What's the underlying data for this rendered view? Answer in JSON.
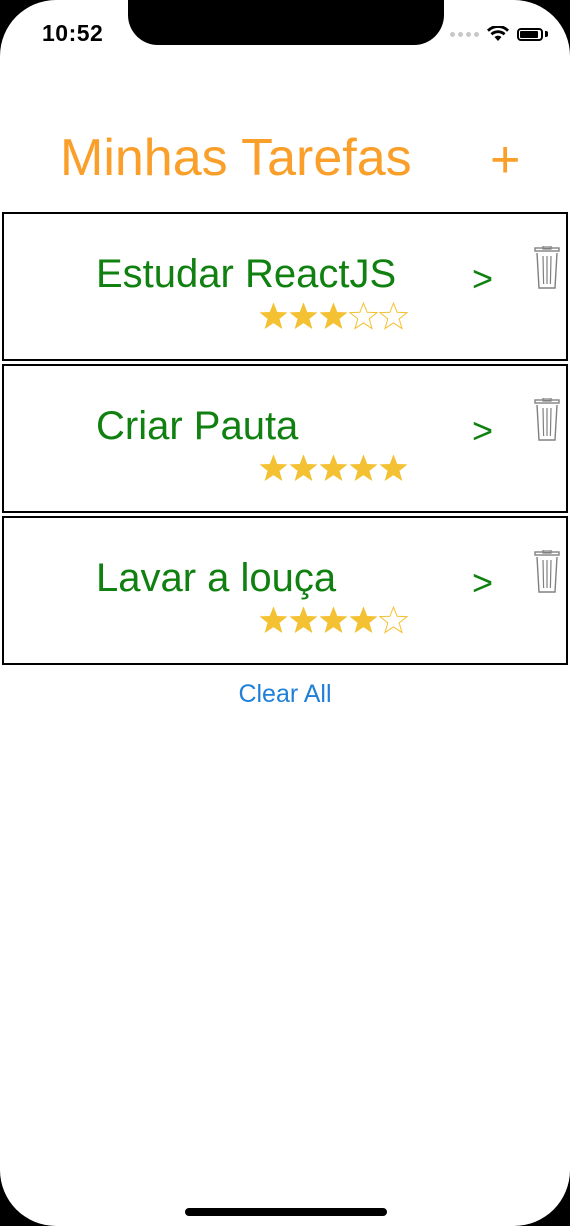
{
  "status_bar": {
    "time": "10:52"
  },
  "header": {
    "title": "Minhas Tarefas",
    "add_label": "+"
  },
  "tasks": [
    {
      "title": "Estudar ReactJS",
      "rating": 3,
      "max_rating": 5,
      "chevron": ">"
    },
    {
      "title": "Criar Pauta",
      "rating": 5,
      "max_rating": 5,
      "chevron": ">"
    },
    {
      "title": "Lavar a louça",
      "rating": 4,
      "max_rating": 5,
      "chevron": ">"
    }
  ],
  "footer": {
    "clear_label": "Clear All"
  },
  "colors": {
    "accent": "#fa9f2a",
    "task_text": "#108010",
    "star_filled": "#f4c132",
    "link": "#2080d8"
  }
}
